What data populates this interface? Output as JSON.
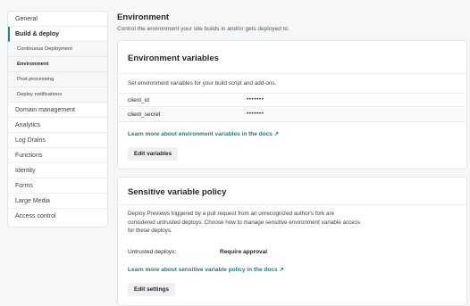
{
  "sidebar": {
    "items": [
      {
        "label": "General"
      },
      {
        "label": "Build & deploy"
      },
      {
        "label": "Continuous Deployment"
      },
      {
        "label": "Environment"
      },
      {
        "label": "Post processing"
      },
      {
        "label": "Deploy notifications"
      },
      {
        "label": "Domain management"
      },
      {
        "label": "Analytics"
      },
      {
        "label": "Log Drains"
      },
      {
        "label": "Functions"
      },
      {
        "label": "Identity"
      },
      {
        "label": "Forms"
      },
      {
        "label": "Large Media"
      },
      {
        "label": "Access control"
      }
    ]
  },
  "main": {
    "title": "Environment",
    "subtitle": "Control the environment your site builds in and/or gets deployed to."
  },
  "env_vars": {
    "title": "Environment variables",
    "description": "Set environment variables for your build script and add-ons.",
    "rows": [
      {
        "key": "client_id",
        "value": "•••••••"
      },
      {
        "key": "client_secret",
        "value": "•••••••"
      }
    ],
    "link": "Learn more about environment variables in the docs ↗",
    "button": "Edit variables"
  },
  "policy": {
    "title": "Sensitive variable policy",
    "description_lines": [
      "Deploy Previews triggered by a pull request from an unrecognized author's fork are",
      "considered untrusted deploys. Choose how to manage sensitive environment variable access",
      "for these deploys."
    ],
    "untrusted_label": "Untrusted deploys:",
    "untrusted_value": "Require approval",
    "link": "Learn more about sensitive variable policy in the docs ↗",
    "button": "Edit settings"
  },
  "colors": {
    "accent": "#1c7c78",
    "background": "#f6f7f8"
  }
}
